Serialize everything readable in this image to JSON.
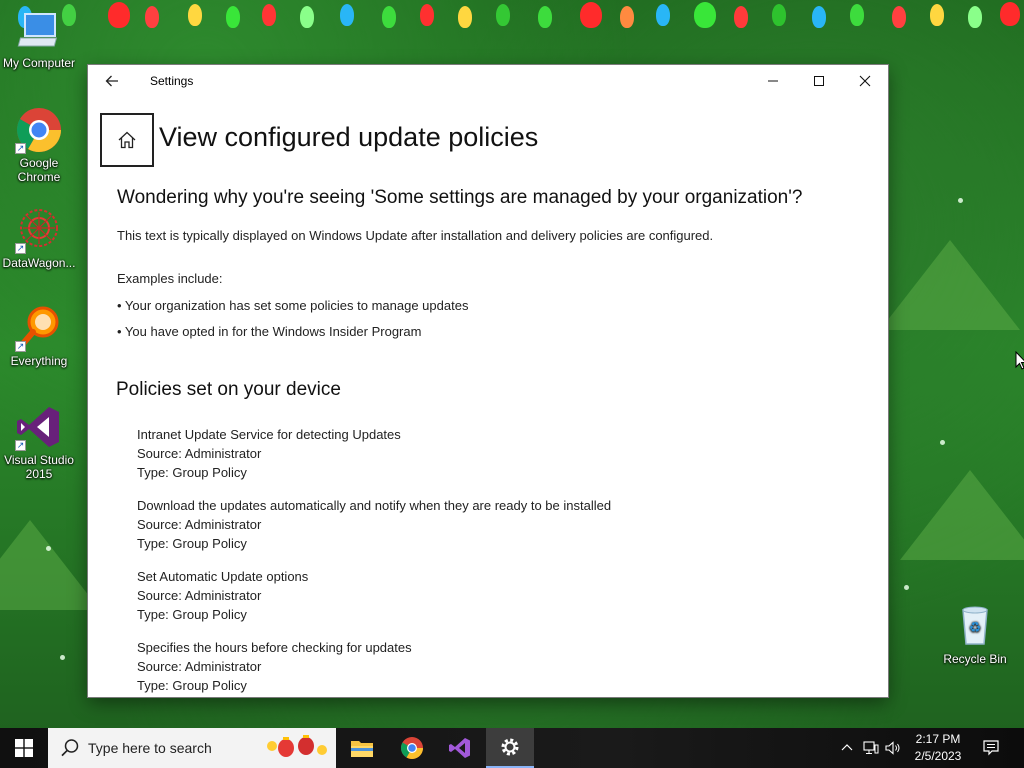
{
  "desktop": {
    "icons": [
      {
        "label": "My Computer"
      },
      {
        "label": "Google Chrome"
      },
      {
        "label": "DataWagon..."
      },
      {
        "label": "Everything"
      },
      {
        "label": "Visual Studio 2015"
      },
      {
        "label": "Recycle Bin"
      }
    ]
  },
  "window": {
    "title": "Settings",
    "page_title": "View configured update policies",
    "subheading": "Wondering why you're seeing 'Some settings are managed by your organization'?",
    "intro": "This text is typically displayed on Windows Update after installation and delivery policies are configured.",
    "examples_label": "Examples include:",
    "examples": [
      "• Your organization has set some policies to manage updates",
      "• You have opted in for the Windows Insider Program"
    ],
    "section_title": "Policies set on your device",
    "policies": [
      {
        "name": "Intranet Update Service for detecting Updates",
        "source": "Source: Administrator",
        "type": "Type: Group Policy"
      },
      {
        "name": "Download the updates automatically and notify when they are ready to be installed",
        "source": "Source: Administrator",
        "type": "Type: Group Policy"
      },
      {
        "name": "Set Automatic Update options",
        "source": "Source: Administrator",
        "type": "Type: Group Policy"
      },
      {
        "name": "Specifies the hours before checking for updates",
        "source": "Source: Administrator",
        "type": "Type: Group Policy"
      }
    ]
  },
  "taskbar": {
    "search_placeholder": "Type here to search",
    "time": "2:17 PM",
    "date": "2/5/2023"
  },
  "colors": {
    "accent": "#0078d4",
    "taskbar_bg": "#141414",
    "window_bg": "#ffffff"
  }
}
